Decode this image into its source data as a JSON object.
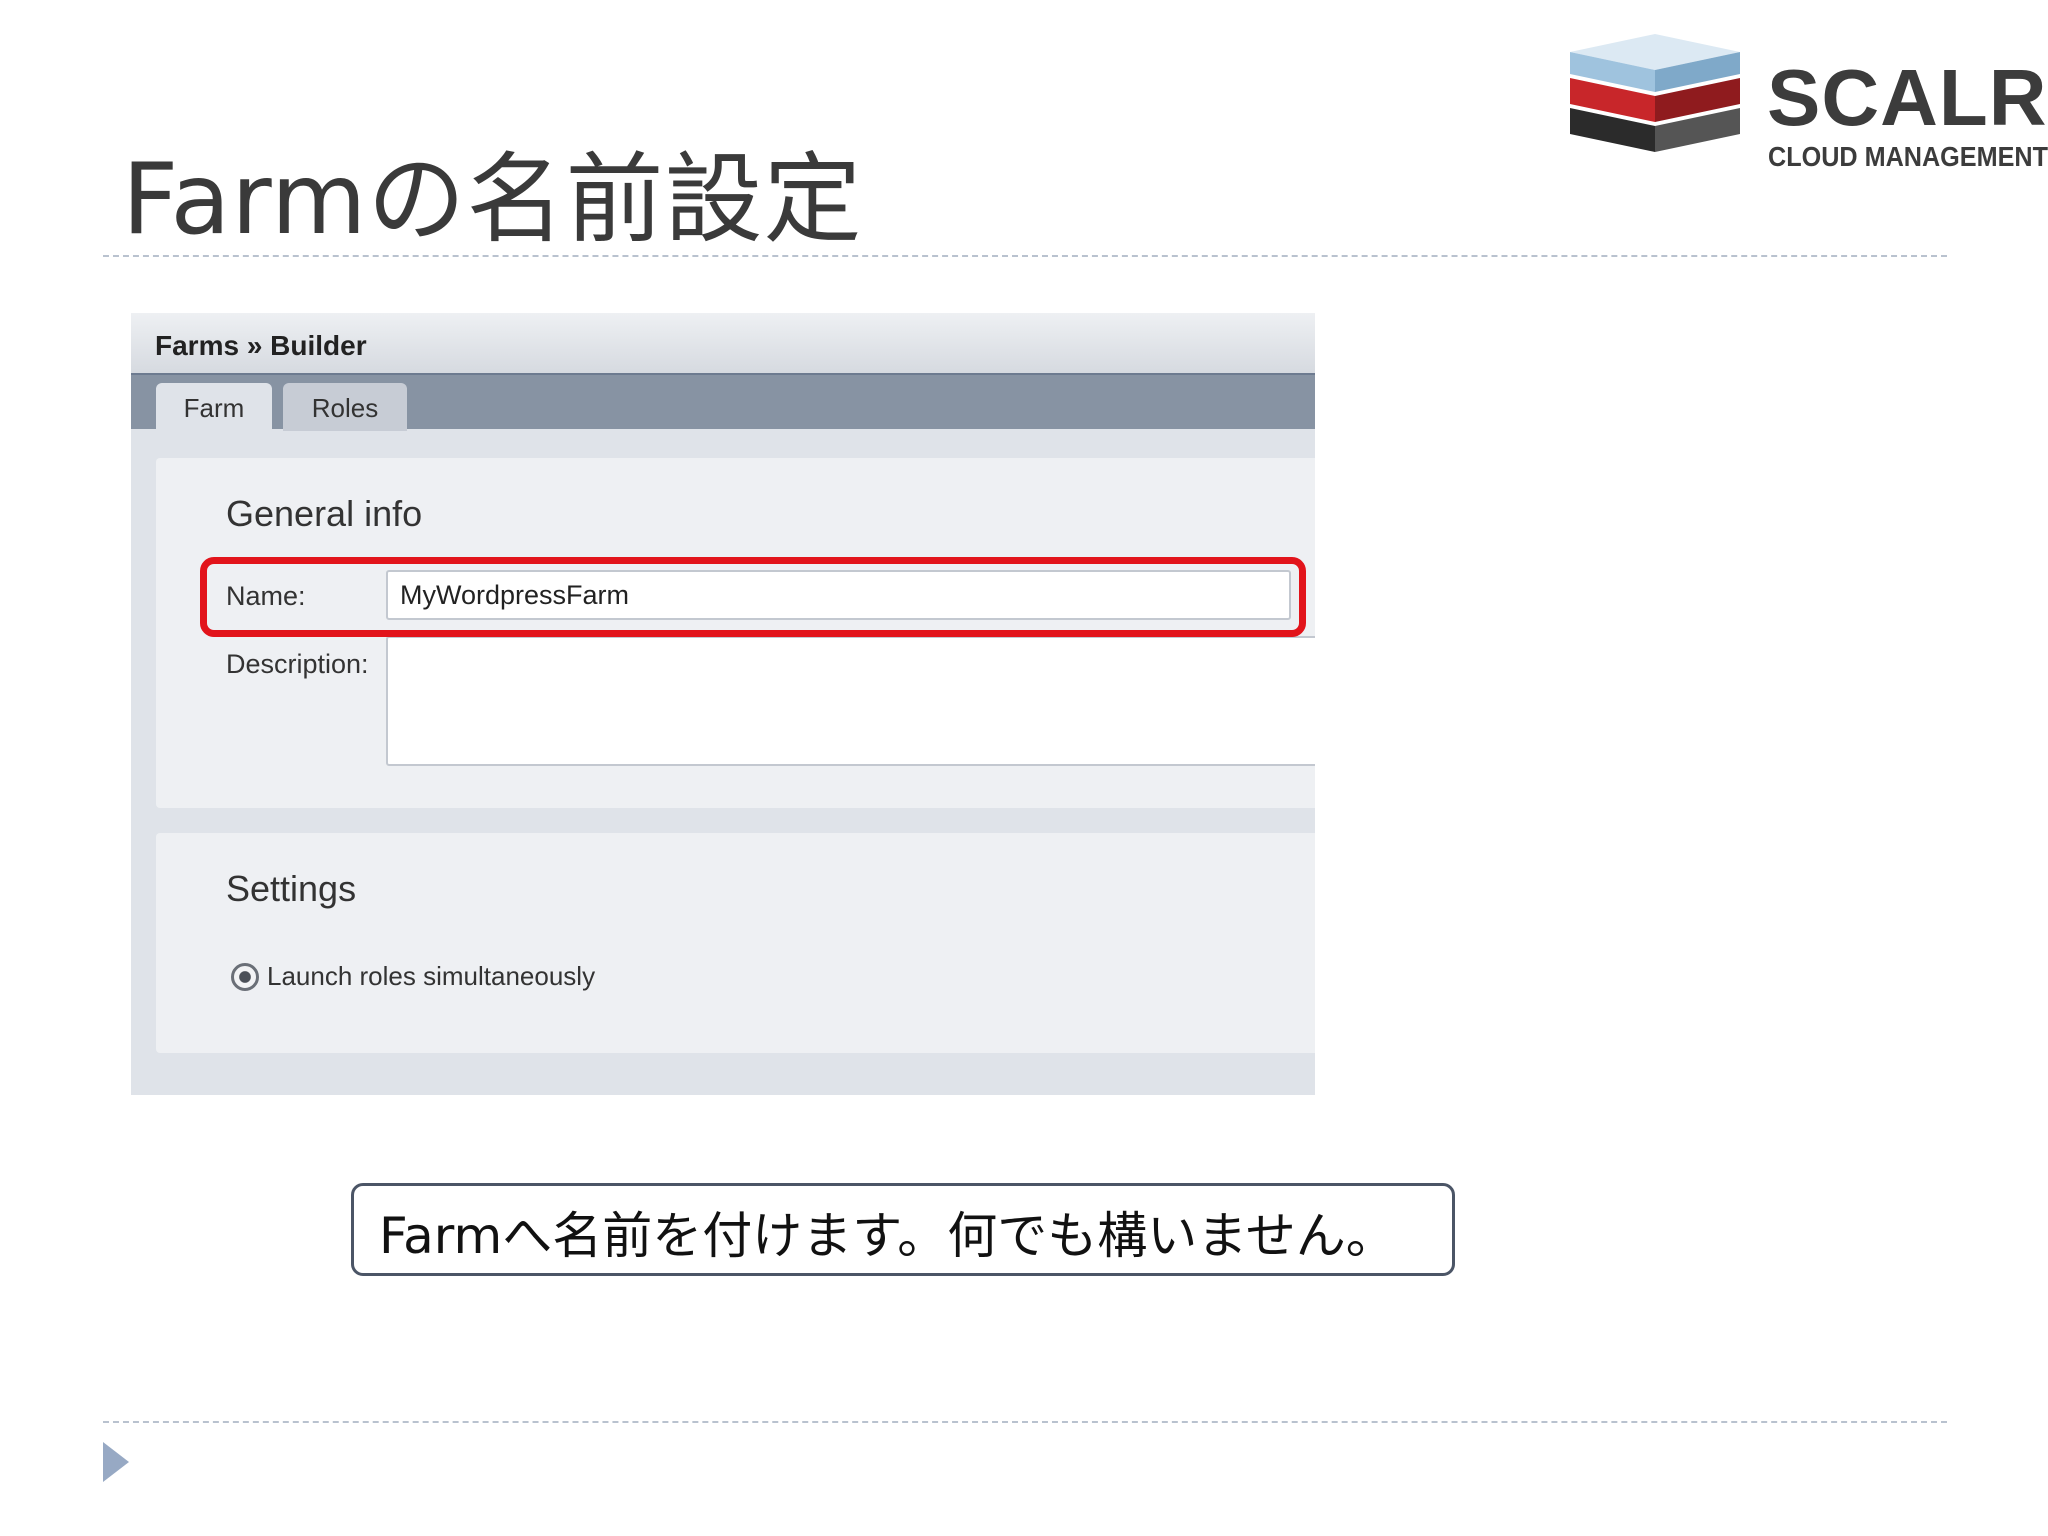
{
  "slide": {
    "title": "Farmの名前設定",
    "caption": "Farmへ名前を付けます。何でも構いません。"
  },
  "logo": {
    "word": "SCALR",
    "subtitle": "CLOUD MANAGEMENT"
  },
  "app": {
    "breadcrumb": "Farms » Builder",
    "tabs": [
      {
        "label": "Farm",
        "active": true
      },
      {
        "label": "Roles",
        "active": false
      }
    ],
    "general_info": {
      "title": "General info",
      "name_label": "Name:",
      "name_value": "MyWordpressFarm",
      "description_label": "Description:",
      "description_value": ""
    },
    "settings": {
      "title": "Settings",
      "radio_label": "Launch roles simultaneously"
    }
  },
  "colors": {
    "highlight": "#e2141b",
    "tabbar": "#8793a3",
    "panel": "#dfe3e9",
    "logo_red": "#c8262a",
    "logo_blue": "#9fc3de"
  }
}
